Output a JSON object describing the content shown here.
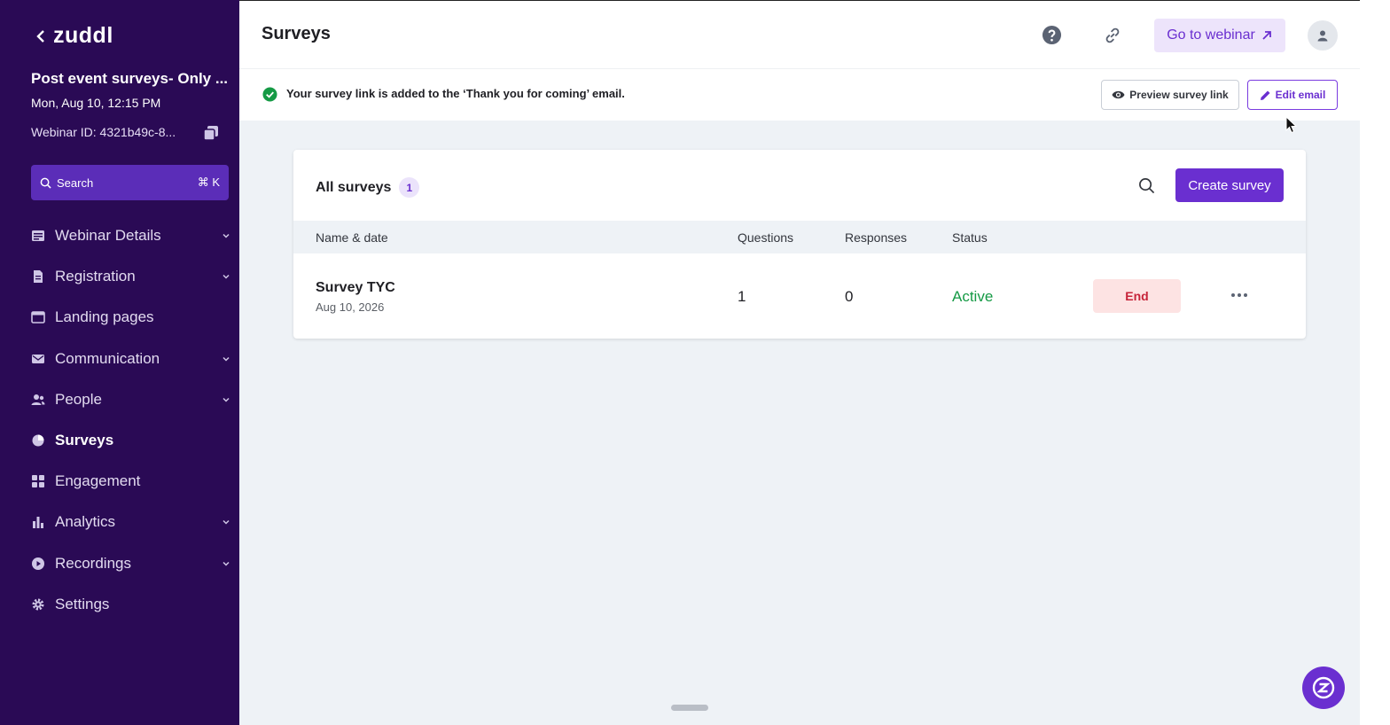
{
  "sidebar": {
    "logo": "zuddl",
    "event_title": "Post event surveys- Only ...",
    "event_date": "Mon, Aug 10, 12:15 PM",
    "webinar_id": "Webinar ID: 4321b49c-8...",
    "search_label": "Search",
    "search_shortcut": "⌘ K",
    "items": [
      {
        "label": "Webinar Details",
        "icon": "list-icon",
        "has_chevron": true
      },
      {
        "label": "Registration",
        "icon": "document-icon",
        "has_chevron": true
      },
      {
        "label": "Landing pages",
        "icon": "browser-icon",
        "has_chevron": false
      },
      {
        "label": "Communication",
        "icon": "mail-icon",
        "has_chevron": true
      },
      {
        "label": "People",
        "icon": "people-icon",
        "has_chevron": true
      },
      {
        "label": "Surveys",
        "icon": "pie-chart-icon",
        "has_chevron": false,
        "active": true
      },
      {
        "label": "Engagement",
        "icon": "grid-icon",
        "has_chevron": false
      },
      {
        "label": "Analytics",
        "icon": "bar-chart-icon",
        "has_chevron": true
      },
      {
        "label": "Recordings",
        "icon": "play-circle-icon",
        "has_chevron": true
      },
      {
        "label": "Settings",
        "icon": "gear-icon",
        "has_chevron": false
      }
    ]
  },
  "header": {
    "title": "Surveys",
    "go_to_webinar": "Go to webinar"
  },
  "notice": {
    "message": "Your survey link is added to the ‘Thank you for coming’ email.",
    "preview_label": "Preview survey link",
    "edit_label": "Edit email"
  },
  "surveys": {
    "title": "All surveys",
    "count": "1",
    "create_label": "Create survey",
    "columns": [
      "Name & date",
      "Questions",
      "Responses",
      "Status"
    ],
    "rows": [
      {
        "name": "Survey TYC",
        "date": "Aug 10, 2026",
        "questions": "1",
        "responses": "0",
        "status": "Active",
        "action": "End"
      }
    ]
  },
  "colors": {
    "sidebar_bg": "#2a0a55",
    "accent": "#6a2fd0",
    "active_status": "#159a45",
    "end_bg": "#fde3e3",
    "end_text": "#c7243a"
  }
}
